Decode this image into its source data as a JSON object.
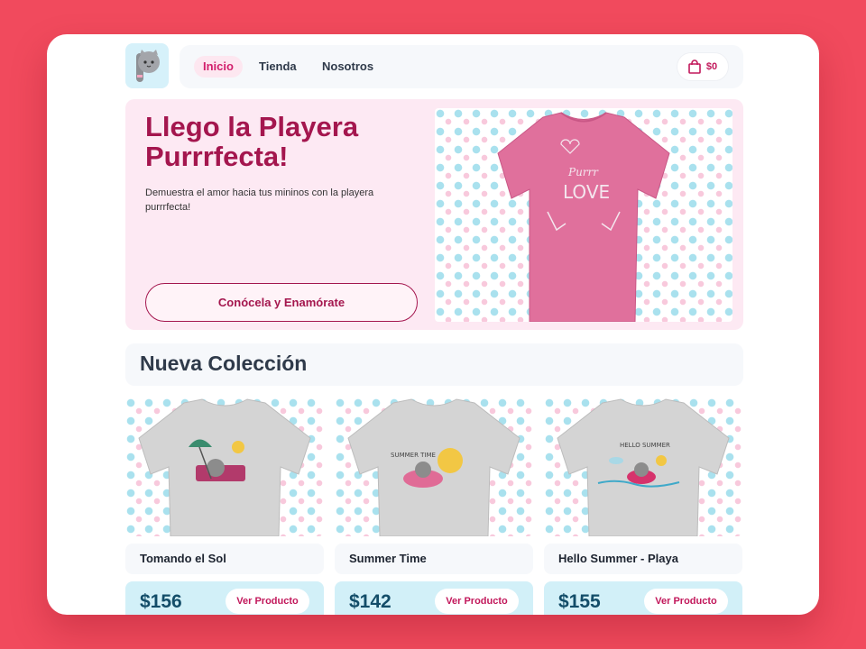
{
  "nav": {
    "items": [
      {
        "label": "Inicio",
        "active": true
      },
      {
        "label": "Tienda",
        "active": false
      },
      {
        "label": "Nosotros",
        "active": false
      }
    ],
    "cart_total": "$0",
    "cart_icon": "shopping-bag-icon",
    "logo_icon": "cat-logo-icon"
  },
  "hero": {
    "title": "Llego la Playera Purrrfecta!",
    "description": "Demuestra el amor hacia tus mininos con la playera purrrfecta!",
    "cta_label": "Conócela y Enamórate",
    "shirt_lines": [
      "Purrr",
      "LOVE"
    ]
  },
  "collection": {
    "title": "Nueva Colección",
    "products": [
      {
        "name": "Tomando el Sol",
        "price": "$156",
        "button_label": "Ver Producto",
        "print_text": ""
      },
      {
        "name": "Summer Time",
        "price": "$142",
        "button_label": "Ver Producto",
        "print_text": "SUMMER TIME"
      },
      {
        "name": "Hello Summer - Playa",
        "price": "$155",
        "button_label": "Ver Producto",
        "print_text": "HELLO SUMMER"
      }
    ]
  },
  "colors": {
    "background": "#f14a5d",
    "accent": "#c2185b",
    "hero_bg": "#fde9f3",
    "buy_bg": "#d2f0f8",
    "shirt_pink": "#e0709c",
    "shirt_grey": "#d4d4d4"
  }
}
